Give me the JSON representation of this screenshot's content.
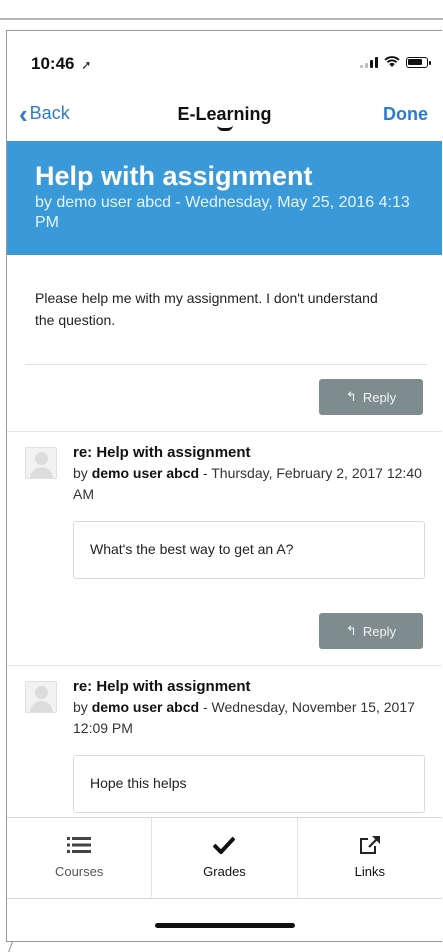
{
  "status_bar": {
    "time": "10:46",
    "location_glyph": "➚",
    "wifi_glyph": "⌔"
  },
  "nav": {
    "back_label": "Back",
    "title": "E-Learning",
    "done_label": "Done"
  },
  "discussion": {
    "title": "Help with assignment",
    "byline": "by demo user abcd - Wednesday, May 25, 2016 4:13 PM",
    "body": "Please help me with my assignment. I don't understand the question.",
    "reply_label": "Reply"
  },
  "replies": [
    {
      "title": "re: Help with assignment",
      "by_prefix": "by",
      "author": "demo user abcd",
      "date_line": " - Thursday, February 2, 2017 12:40 AM",
      "message": "What's the best way to get an A?",
      "reply_label": "Reply"
    },
    {
      "title": "re: Help with assignment",
      "by_prefix": "by",
      "author": "demo user abcd",
      "date_line": " - Wednesday, November 15, 2017 12:09 PM",
      "message": "Hope this helps"
    }
  ],
  "tab_bar": {
    "tabs": [
      {
        "label": "Courses",
        "icon": "list-icon"
      },
      {
        "label": "Grades",
        "icon": "checkmark-icon"
      },
      {
        "label": "Links",
        "icon": "external-link-icon"
      }
    ]
  },
  "colors": {
    "accent": "#2b7cd3",
    "header_band": "#3a9ad9",
    "reply_button": "#7f8c8d"
  }
}
